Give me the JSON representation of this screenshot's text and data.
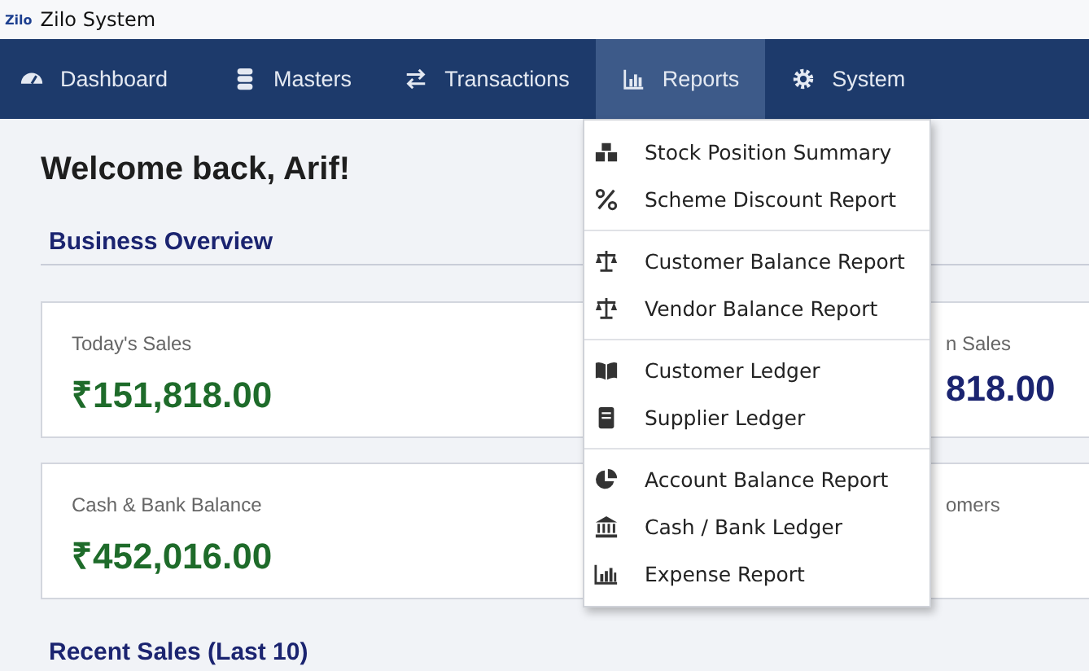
{
  "window": {
    "logo": "Zilo",
    "title": "Zilo System"
  },
  "nav": [
    {
      "label": "Dashboard",
      "selected": false
    },
    {
      "label": "Masters",
      "selected": false
    },
    {
      "label": "Transactions",
      "selected": false
    },
    {
      "label": "Reports",
      "selected": true
    },
    {
      "label": "System",
      "selected": false
    }
  ],
  "reports_menu": [
    [
      {
        "label": "Stock Position Summary"
      },
      {
        "label": "Scheme Discount Report"
      }
    ],
    [
      {
        "label": "Customer Balance Report"
      },
      {
        "label": "Vendor Balance Report"
      }
    ],
    [
      {
        "label": "Customer Ledger"
      },
      {
        "label": "Supplier Ledger"
      }
    ],
    [
      {
        "label": "Account Balance Report"
      },
      {
        "label": "Cash / Bank Ledger"
      },
      {
        "label": "Expense Report"
      }
    ]
  ],
  "greeting": "Welcome back, Arif!",
  "section_title": "Business Overview",
  "cards": [
    [
      {
        "label": "Today's Sales",
        "value": "₹151,818.00",
        "color": "#1e6b2a"
      },
      {
        "label": "n Sales",
        "value": "818.00",
        "color": "#1b2470"
      }
    ],
    [
      {
        "label": "Cash & Bank Balance",
        "value": "₹452,016.00",
        "color": "#1e6b2a"
      },
      {
        "label": "omers"
      }
    ]
  ],
  "recent_title": "Recent Sales (Last 10)"
}
